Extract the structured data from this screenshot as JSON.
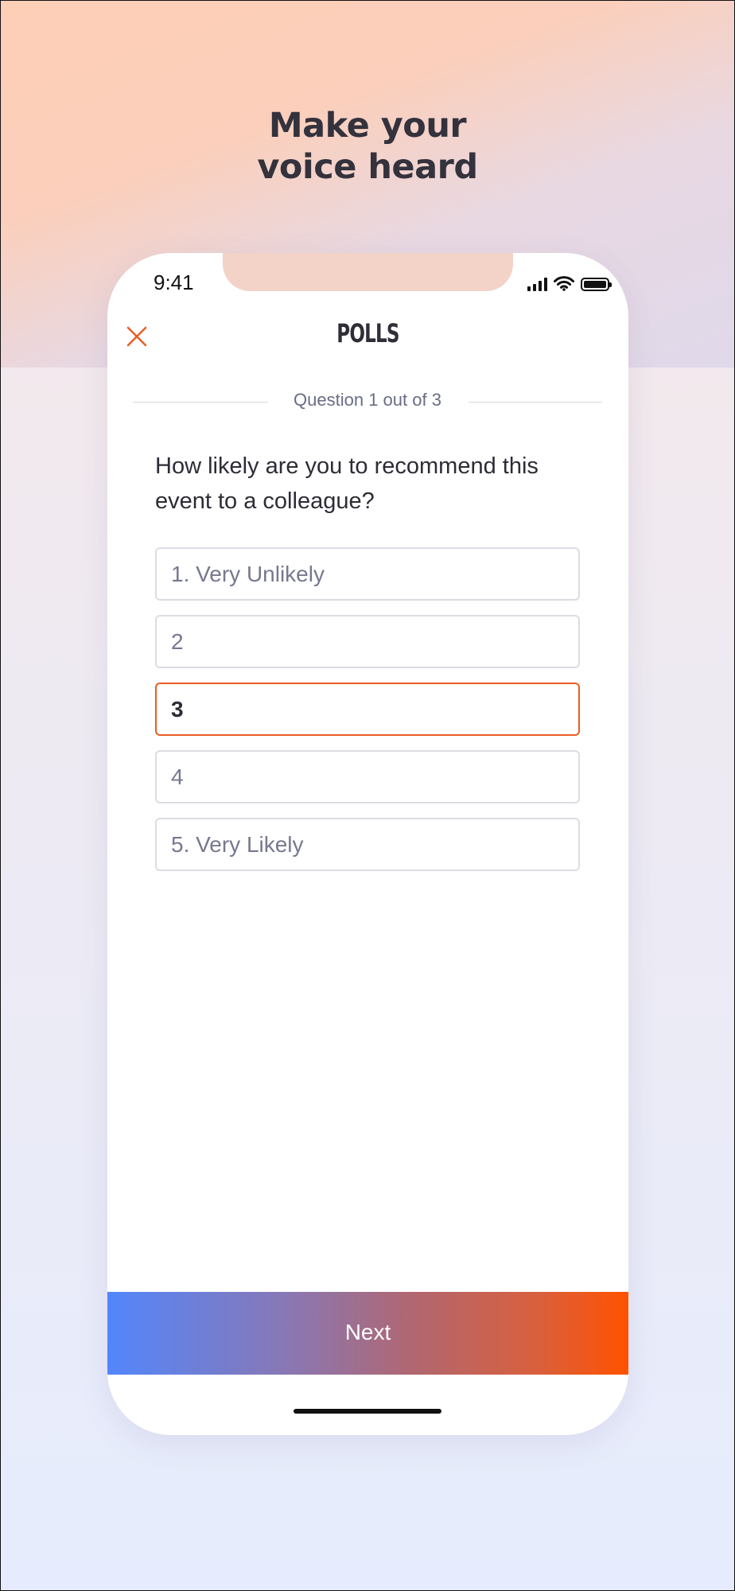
{
  "headline": {
    "line1": "Make your",
    "line2": "voice heard"
  },
  "status_bar": {
    "time": "9:41",
    "icons": [
      "signal-icon",
      "wifi-icon",
      "battery-icon"
    ]
  },
  "header": {
    "title": "POLLS",
    "close_icon": "close-icon"
  },
  "progress": {
    "label": "Question 1 out of 3"
  },
  "question": {
    "text": "How likely are you to recommend this event to a colleague?"
  },
  "options": [
    {
      "label": "1. Very Unlikely",
      "selected": false
    },
    {
      "label": "2",
      "selected": false
    },
    {
      "label": "3",
      "selected": true
    },
    {
      "label": "4",
      "selected": false
    },
    {
      "label": "5. Very Likely",
      "selected": false
    }
  ],
  "next_button": {
    "label": "Next"
  },
  "colors": {
    "accent": "#ea5d22",
    "gradient_start": "#5286fb",
    "gradient_end": "#ff5200",
    "text_dark": "#2d2c36",
    "text_muted": "#686d86"
  }
}
